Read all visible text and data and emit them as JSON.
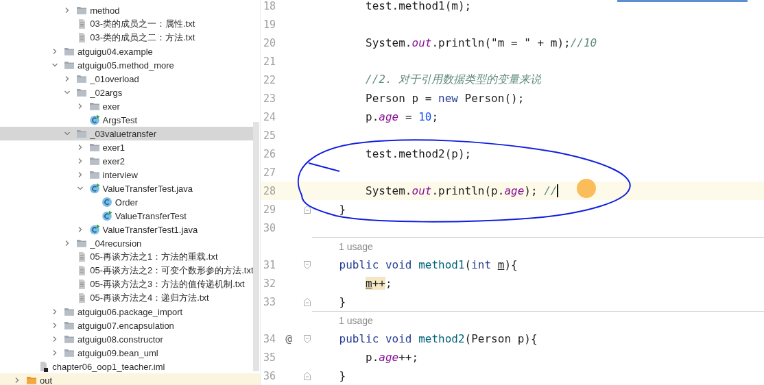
{
  "project_tree": {
    "items": [
      {
        "children": [
          {
            "children": [
              {
                "children": [
                  {
                    "children": [
                      {
                        "label": "method",
                        "kind": "folder",
                        "expanded": false,
                        "selected": false
                      },
                      {
                        "label": "03-类的成员之一：属性.txt",
                        "kind": "text-file",
                        "selected": false
                      },
                      {
                        "label": "03-类的成员之二：方法.txt",
                        "kind": "text-file",
                        "selected": false
                      }
                    ]
                  },
                  {
                    "label": "atguigu04.example",
                    "kind": "folder",
                    "expanded": false,
                    "selected": false
                  },
                  {
                    "label": "atguigu05.method_more",
                    "kind": "folder",
                    "expanded": true,
                    "selected": false,
                    "children": [
                      {
                        "label": "_01overload",
                        "kind": "folder",
                        "expanded": false,
                        "selected": false
                      },
                      {
                        "label": "_02args",
                        "kind": "folder",
                        "expanded": true,
                        "selected": false,
                        "children": [
                          {
                            "label": "exer",
                            "kind": "folder",
                            "expanded": false,
                            "selected": false
                          },
                          {
                            "label": "ArgsTest",
                            "kind": "runnable-class",
                            "selected": false
                          }
                        ]
                      },
                      {
                        "label": "_03valuetransfer",
                        "kind": "folder",
                        "expanded": true,
                        "selected": true,
                        "children": [
                          {
                            "label": "exer1",
                            "kind": "folder",
                            "expanded": false,
                            "selected": false
                          },
                          {
                            "label": "exer2",
                            "kind": "folder",
                            "expanded": false,
                            "selected": false
                          },
                          {
                            "label": "interview",
                            "kind": "folder",
                            "expanded": false,
                            "selected": false
                          },
                          {
                            "label": "ValueTransferTest.java",
                            "kind": "runnable-class",
                            "expanded": true,
                            "selected": false,
                            "children": [
                              {
                                "label": "Order",
                                "kind": "class",
                                "selected": false
                              },
                              {
                                "label": "ValueTransferTest",
                                "kind": "runnable-class",
                                "selected": false
                              }
                            ]
                          },
                          {
                            "label": "ValueTransferTest1.java",
                            "kind": "runnable-class",
                            "expanded": false,
                            "selected": false
                          }
                        ]
                      },
                      {
                        "label": "_04recursion",
                        "kind": "folder",
                        "expanded": false,
                        "selected": false
                      },
                      {
                        "label": "05-再谈方法之1：方法的重载.txt",
                        "kind": "text-file",
                        "selected": false
                      },
                      {
                        "label": "05-再谈方法之2：可变个数形参的方法.txt",
                        "kind": "text-file",
                        "selected": false
                      },
                      {
                        "label": "05-再谈方法之3：方法的值传递机制.txt",
                        "kind": "text-file",
                        "selected": false
                      },
                      {
                        "label": "05-再谈方法之4：递归方法.txt",
                        "kind": "text-file",
                        "selected": false
                      }
                    ]
                  },
                  {
                    "label": "atguigu06.package_import",
                    "kind": "folder",
                    "expanded": false,
                    "selected": false
                  },
                  {
                    "label": "atguigu07.encapsulation",
                    "kind": "folder",
                    "expanded": false,
                    "selected": false
                  },
                  {
                    "label": "atguigu08.constructor",
                    "kind": "folder",
                    "expanded": false,
                    "selected": false
                  },
                  {
                    "label": "atguigu09.bean_uml",
                    "kind": "folder",
                    "expanded": false,
                    "selected": false
                  }
                ]
              }
            ]
          },
          {
            "label": "chapter06_oop1_teacher.iml",
            "kind": "module-file",
            "selected": false
          }
        ]
      },
      {
        "label": "out",
        "kind": "excluded-folder",
        "expanded": false,
        "selected": false
      }
    ]
  },
  "editor": {
    "lines": [
      {
        "kind": "code",
        "number": "18",
        "tokens": [
          {
            "text": "        test.method1(m);",
            "kind": "plain"
          }
        ]
      },
      {
        "kind": "code",
        "number": "19"
      },
      {
        "kind": "code",
        "number": "20",
        "tokens": [
          {
            "text": "        System.",
            "kind": "plain"
          },
          {
            "text": "out",
            "kind": "field"
          },
          {
            "text": ".println(\"m = \" + m);",
            "kind": "plain"
          },
          {
            "text": "//10",
            "kind": "comment"
          }
        ]
      },
      {
        "kind": "code",
        "number": "21"
      },
      {
        "kind": "code",
        "number": "22",
        "tokens": [
          {
            "text": "        //2. 对于引用数据类型的变量来说",
            "kind": "comment"
          }
        ]
      },
      {
        "kind": "code",
        "number": "23",
        "tokens": [
          {
            "text": "        Person p = ",
            "kind": "plain"
          },
          {
            "text": "new",
            "kind": "keyword"
          },
          {
            "text": " Person();",
            "kind": "plain"
          }
        ]
      },
      {
        "kind": "code",
        "number": "24",
        "tokens": [
          {
            "text": "        p.",
            "kind": "plain"
          },
          {
            "text": "age",
            "kind": "field"
          },
          {
            "text": " = ",
            "kind": "plain"
          },
          {
            "text": "10",
            "kind": "number"
          },
          {
            "text": ";",
            "kind": "plain"
          }
        ]
      },
      {
        "kind": "code",
        "number": "25"
      },
      {
        "kind": "code",
        "number": "26",
        "tokens": [
          {
            "text": "        test.method2(p);",
            "kind": "plain"
          }
        ]
      },
      {
        "kind": "code",
        "number": "27"
      },
      {
        "kind": "code",
        "number": "28",
        "current": true,
        "caret": true,
        "tokens": [
          {
            "text": "        System.",
            "kind": "plain"
          },
          {
            "text": "out",
            "kind": "field"
          },
          {
            "text": ".println(p.",
            "kind": "plain"
          },
          {
            "text": "age",
            "kind": "field"
          },
          {
            "text": "); ",
            "kind": "plain"
          },
          {
            "text": "//",
            "kind": "comment"
          }
        ]
      },
      {
        "kind": "code",
        "number": "29",
        "fold_end": true,
        "tokens": [
          {
            "text": "    }",
            "kind": "plain"
          }
        ]
      },
      {
        "kind": "code",
        "number": "30"
      },
      {
        "kind": "usage",
        "text": "1 usage"
      },
      {
        "kind": "code",
        "number": "31",
        "fold_start": true,
        "tokens": [
          {
            "text": "    public ",
            "kind": "keyword"
          },
          {
            "text": "void ",
            "kind": "keyword"
          },
          {
            "text": "method1",
            "kind": "declaration"
          },
          {
            "text": "(",
            "kind": "plain"
          },
          {
            "text": "int ",
            "kind": "keyword"
          },
          {
            "text": "m",
            "kind": "parameter"
          },
          {
            "text": "){",
            "kind": "plain"
          }
        ]
      },
      {
        "kind": "code",
        "number": "32",
        "tokens": [
          {
            "text": "        m",
            "kind": "parameter-highlight"
          },
          {
            "text": "++",
            "kind": "highlight"
          },
          {
            "text": ";",
            "kind": "plain"
          }
        ]
      },
      {
        "kind": "code",
        "number": "33",
        "fold_end": true,
        "tokens": [
          {
            "text": "    }",
            "kind": "plain"
          }
        ]
      },
      {
        "kind": "usage",
        "text": "1 usage"
      },
      {
        "kind": "code",
        "number": "34",
        "gutter_mark": "@",
        "fold_start": true,
        "tokens": [
          {
            "text": "    public ",
            "kind": "keyword"
          },
          {
            "text": "void ",
            "kind": "keyword"
          },
          {
            "text": "method2",
            "kind": "declaration"
          },
          {
            "text": "(Person p){",
            "kind": "plain"
          }
        ]
      },
      {
        "kind": "code",
        "number": "35",
        "tokens": [
          {
            "text": "        p.",
            "kind": "plain"
          },
          {
            "text": "age",
            "kind": "field"
          },
          {
            "text": "++;",
            "kind": "plain"
          }
        ]
      },
      {
        "kind": "code",
        "number": "36",
        "fold_end": true,
        "tokens": [
          {
            "text": "    }",
            "kind": "plain"
          }
        ]
      }
    ]
  }
}
